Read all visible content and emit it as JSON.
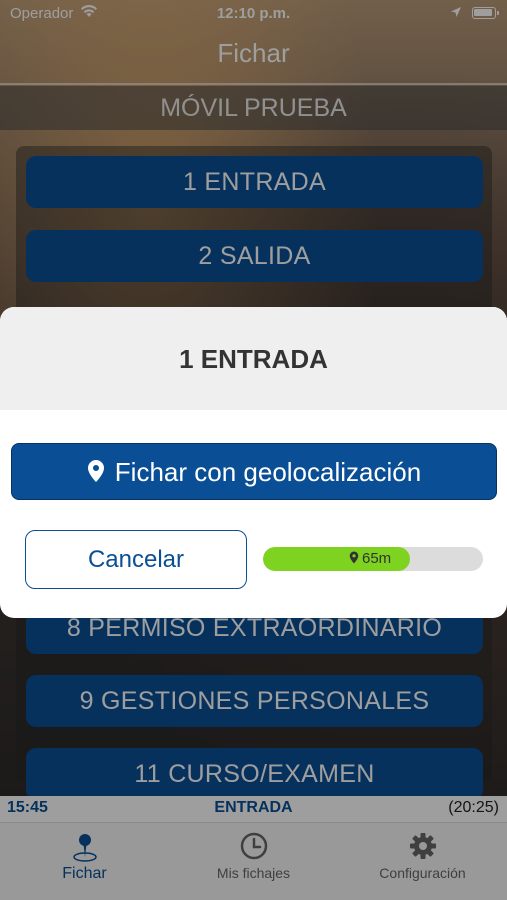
{
  "status": {
    "carrier": "Operador",
    "time": "12:10 p.m."
  },
  "nav": {
    "title": "Fichar"
  },
  "device_name": "MÓVIL PRUEBA",
  "actions": [
    {
      "label": "1  ENTRADA"
    },
    {
      "label": "2  SALIDA"
    },
    {
      "label": "8  PERMISO EXTRAORDINARIO"
    },
    {
      "label": "9  GESTIONES PERSONALES"
    },
    {
      "label": "11  CURSO/EXAMEN"
    }
  ],
  "modal": {
    "title": "1 ENTRADA",
    "geo_button": "Fichar con geolocalización",
    "cancel_button": "Cancelar",
    "precision_label": "65m",
    "precision_fill": 0.67,
    "precision_color": "#7ed321"
  },
  "infobar": {
    "time": "15:45",
    "state": "ENTRADA",
    "duration": "(20:25)"
  },
  "tabs": [
    {
      "label": "Fichar",
      "icon": "map-pin-icon"
    },
    {
      "label": "Mis fichajes",
      "icon": "clock-icon"
    },
    {
      "label": "Configuración",
      "icon": "gear-icon"
    }
  ],
  "colors": {
    "primary": "#0a4f95",
    "progress": "#7ed321"
  }
}
